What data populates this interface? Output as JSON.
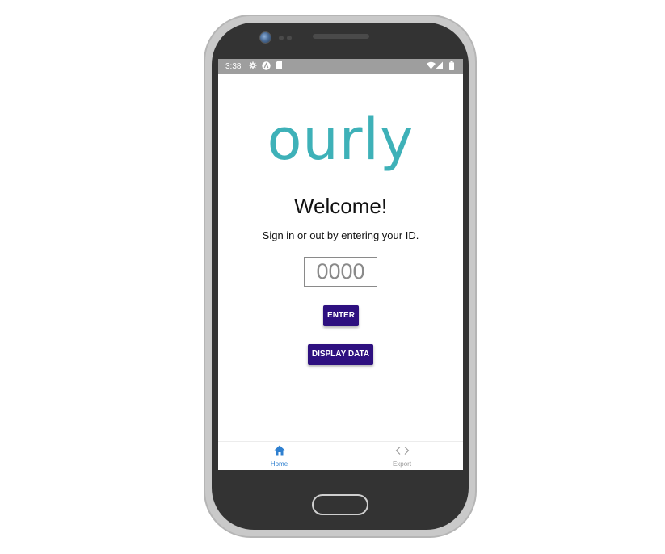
{
  "status_bar": {
    "time": "3:38",
    "left_icons": [
      "settings-icon",
      "a-circle-icon",
      "sd-card-icon"
    ],
    "right_icons": [
      "wifi-icon",
      "signal-icon",
      "battery-icon"
    ]
  },
  "app": {
    "logo_text": "ourly",
    "welcome": "Welcome!",
    "subtitle": "Sign in or out by entering your ID.",
    "id_input": {
      "value": "",
      "placeholder": "0000"
    },
    "enter_label": "ENTER",
    "display_data_label": "DISPLAY DATA"
  },
  "bottom_nav": {
    "items": [
      {
        "label": "Home",
        "icon": "home-icon",
        "active": true
      },
      {
        "label": "Export",
        "icon": "code-icon",
        "active": false
      }
    ]
  },
  "colors": {
    "logo": "#3eb1b8",
    "button": "#2e1080",
    "nav_active": "#2f80d0",
    "nav_inactive": "#9a9a9a",
    "status_bar": "#9e9e9e",
    "phone_body": "#333333"
  }
}
